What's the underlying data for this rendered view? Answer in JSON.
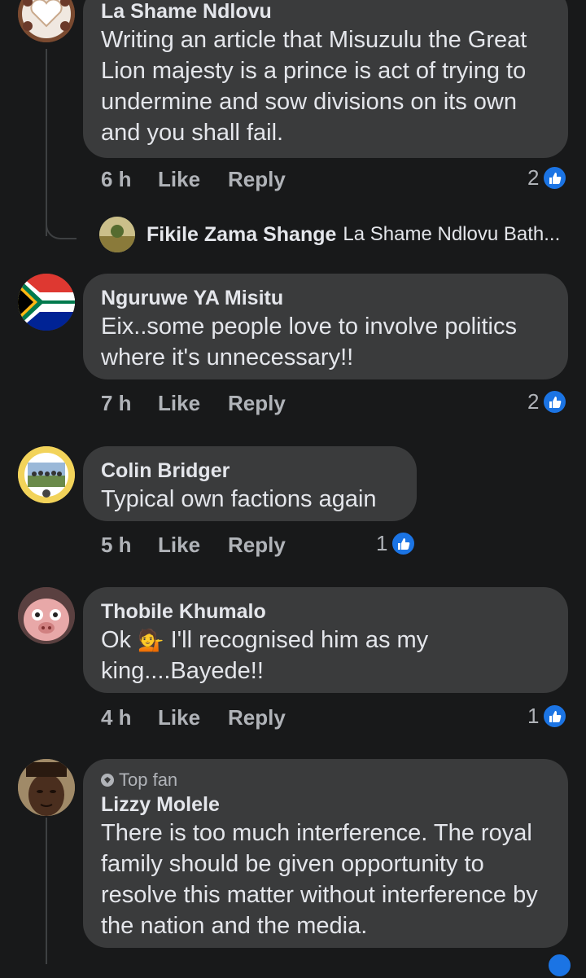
{
  "comments": [
    {
      "name": "La Shame Ndlovu",
      "text": "Writing an article that Misuzulu the Great Lion majesty is a prince is act of trying to undermine and sow divisions on its own and you shall fail.",
      "time": "6 h",
      "like": "Like",
      "reply": "Reply",
      "reactions": "2"
    },
    {
      "name": "Nguruwe YA Misitu",
      "text": "Eix..some people love to involve politics where it's unnecessary!!",
      "time": "7 h",
      "like": "Like",
      "reply": "Reply",
      "reactions": "2"
    },
    {
      "name": "Colin Bridger",
      "text": "Typical own factions again",
      "time": "5 h",
      "like": "Like",
      "reply": "Reply",
      "reactions": "1"
    },
    {
      "name": "Thobile Khumalo",
      "text_a": "Ok",
      "emoji": "💁",
      "text_b": "I'll recognised him as my king....Bayede!!",
      "time": "4 h",
      "like": "Like",
      "reply": "Reply",
      "reactions": "1"
    },
    {
      "badge": "Top fan",
      "name": "Lizzy Molele",
      "text": "There is too much interference. The royal family should be given opportunity to resolve this matter without interference by the nation and the media."
    }
  ],
  "reply_preview": {
    "name": "Fikile Zama Shange",
    "snippet": "La Shame Ndlovu Bath..."
  },
  "colors": {
    "like_blue": "#1b74e4",
    "bubble": "#3a3b3c",
    "background": "#18191a"
  },
  "icons": [
    "like-thumb-icon",
    "top-fan-diamond-icon",
    "south-africa-flag-avatar"
  ]
}
